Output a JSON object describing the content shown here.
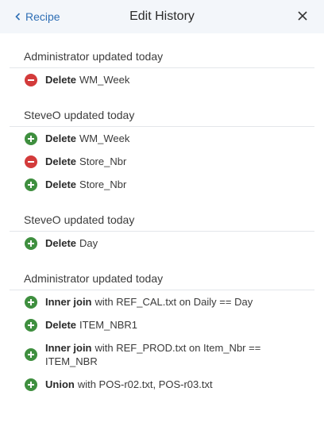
{
  "header": {
    "back_label": "Recipe",
    "title": "Edit History",
    "close_icon": "close-icon"
  },
  "groups": [
    {
      "header": "Administrator updated today",
      "items": [
        {
          "type": "remove",
          "verb": "Delete",
          "text": "WM_Week"
        }
      ]
    },
    {
      "header": "SteveO updated today",
      "items": [
        {
          "type": "add",
          "verb": "Delete",
          "text": "WM_Week"
        },
        {
          "type": "remove",
          "verb": "Delete",
          "text": "Store_Nbr"
        },
        {
          "type": "add",
          "verb": "Delete",
          "text": "Store_Nbr"
        }
      ]
    },
    {
      "header": "SteveO updated today",
      "items": [
        {
          "type": "add",
          "verb": "Delete",
          "text": "Day"
        }
      ]
    },
    {
      "header": "Administrator updated today",
      "items": [
        {
          "type": "add",
          "verb": "Inner join",
          "text": "with REF_CAL.txt on Daily == Day"
        },
        {
          "type": "add",
          "verb": "Delete",
          "text": "ITEM_NBR1"
        },
        {
          "type": "add",
          "verb": "Inner join",
          "text": "with REF_PROD.txt on Item_Nbr == ITEM_NBR"
        },
        {
          "type": "add",
          "verb": "Union",
          "text": "with POS-r02.txt, POS-r03.txt"
        }
      ]
    }
  ],
  "colors": {
    "accent": "#2f6fb5",
    "add": "#3f8f3f",
    "remove": "#d33b3b",
    "header_bg": "#f3f6fa"
  }
}
